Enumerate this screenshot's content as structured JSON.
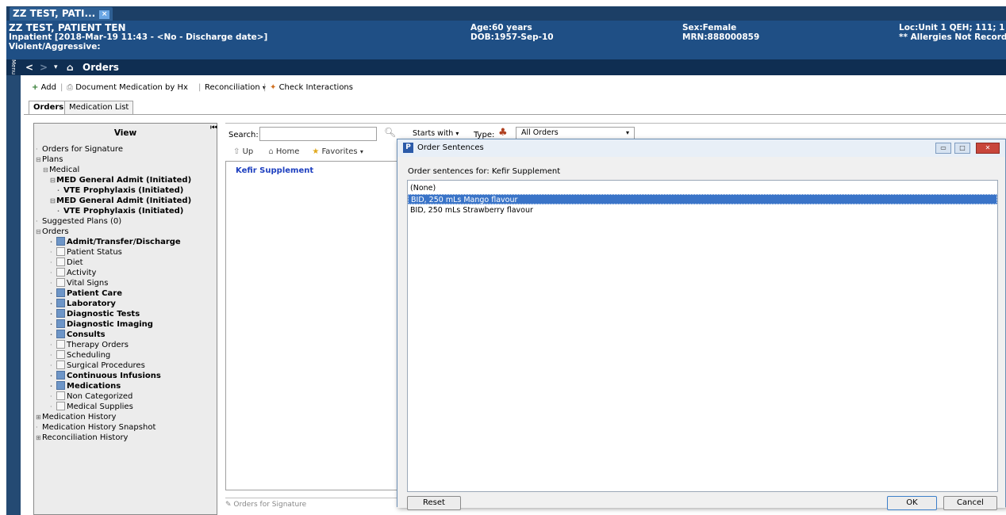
{
  "patient_tab": {
    "label": "ZZ TEST, PATI...",
    "close": "×"
  },
  "banner": {
    "name": "ZZ TEST, PATIENT TEN",
    "encounter": "Inpatient [2018-Mar-19 11:43 - <No - Discharge date>]",
    "alert": "Violent/Aggressive:",
    "age": "Age:60 years",
    "dob": "DOB:1957-Sep-10",
    "sex": "Sex:Female",
    "mrn": "MRN:888000859",
    "loc": "Loc:Unit 1 QEH; 111; 1",
    "allergies": "** Allergies Not Record"
  },
  "navbar": {
    "menu": "Menu",
    "back": "<",
    "forward": ">",
    "page_title": "Orders"
  },
  "toolbar": {
    "add": "Add",
    "document_med": "Document Medication by Hx",
    "reconciliation": "Reconciliation",
    "check_interactions": "Check Interactions"
  },
  "tabs": [
    "Orders",
    "Medication List"
  ],
  "view_panel": {
    "header": "View",
    "items": [
      {
        "label": "Orders for Signature",
        "bold": false,
        "checkbox": "none",
        "indent": 0,
        "expander": ""
      },
      {
        "label": "Plans",
        "bold": false,
        "checkbox": "none",
        "indent": 0,
        "expander": "-"
      },
      {
        "label": "Medical",
        "bold": false,
        "checkbox": "none",
        "indent": 1,
        "expander": "-"
      },
      {
        "label": "MED General Admit (Initiated)",
        "bold": true,
        "checkbox": "none",
        "indent": 2,
        "expander": "-"
      },
      {
        "label": "VTE Prophylaxis (Initiated)",
        "bold": true,
        "checkbox": "none",
        "indent": 3,
        "expander": ""
      },
      {
        "label": "MED General Admit (Initiated)",
        "bold": true,
        "checkbox": "none",
        "indent": 2,
        "expander": "-"
      },
      {
        "label": "VTE Prophylaxis (Initiated)",
        "bold": true,
        "checkbox": "none",
        "indent": 3,
        "expander": ""
      },
      {
        "label": "Suggested Plans (0)",
        "bold": false,
        "checkbox": "none",
        "indent": 0,
        "expander": ""
      },
      {
        "label": "Orders",
        "bold": false,
        "checkbox": "none",
        "indent": 0,
        "expander": "-"
      },
      {
        "label": "Admit/Transfer/Discharge",
        "bold": true,
        "checkbox": "on",
        "indent": 2,
        "expander": ""
      },
      {
        "label": "Patient Status",
        "bold": false,
        "checkbox": "off",
        "indent": 2,
        "expander": ""
      },
      {
        "label": "Diet",
        "bold": false,
        "checkbox": "off",
        "indent": 2,
        "expander": ""
      },
      {
        "label": "Activity",
        "bold": false,
        "checkbox": "off",
        "indent": 2,
        "expander": ""
      },
      {
        "label": "Vital Signs",
        "bold": false,
        "checkbox": "off",
        "indent": 2,
        "expander": ""
      },
      {
        "label": "Patient Care",
        "bold": true,
        "checkbox": "on",
        "indent": 2,
        "expander": ""
      },
      {
        "label": "Laboratory",
        "bold": true,
        "checkbox": "on",
        "indent": 2,
        "expander": ""
      },
      {
        "label": "Diagnostic Tests",
        "bold": true,
        "checkbox": "on",
        "indent": 2,
        "expander": ""
      },
      {
        "label": "Diagnostic Imaging",
        "bold": true,
        "checkbox": "on",
        "indent": 2,
        "expander": ""
      },
      {
        "label": "Consults",
        "bold": true,
        "checkbox": "on",
        "indent": 2,
        "expander": ""
      },
      {
        "label": "Therapy Orders",
        "bold": false,
        "checkbox": "off",
        "indent": 2,
        "expander": ""
      },
      {
        "label": "Scheduling",
        "bold": false,
        "checkbox": "off",
        "indent": 2,
        "expander": ""
      },
      {
        "label": "Surgical Procedures",
        "bold": false,
        "checkbox": "off",
        "indent": 2,
        "expander": ""
      },
      {
        "label": "Continuous Infusions",
        "bold": true,
        "checkbox": "on",
        "indent": 2,
        "expander": ""
      },
      {
        "label": "Medications",
        "bold": true,
        "checkbox": "on",
        "indent": 2,
        "expander": ""
      },
      {
        "label": "Non Categorized",
        "bold": false,
        "checkbox": "off",
        "indent": 2,
        "expander": ""
      },
      {
        "label": "Medical Supplies",
        "bold": false,
        "checkbox": "off",
        "indent": 2,
        "expander": ""
      },
      {
        "label": "Medication History",
        "bold": false,
        "checkbox": "none",
        "indent": 0,
        "expander": "+"
      },
      {
        "label": "Medication History Snapshot",
        "bold": false,
        "checkbox": "none",
        "indent": 0,
        "expander": ""
      },
      {
        "label": "Reconciliation History",
        "bold": false,
        "checkbox": "none",
        "indent": 0,
        "expander": "+"
      }
    ]
  },
  "search": {
    "label": "Search:",
    "value": "",
    "mode": "Starts with",
    "type_label": "Type:",
    "type_value": "All Orders"
  },
  "folder_nav": {
    "up": "Up",
    "home": "Home",
    "favorites": "Favorites"
  },
  "results": [
    "Kefir Supplement"
  ],
  "orders_for_signature_footer": "Orders for Signature",
  "dialog": {
    "title": "Order Sentences",
    "for_label": "Order sentences for:  Kefir Supplement",
    "rows": [
      {
        "text": "(None)",
        "selected": false
      },
      {
        "text": "BID, 250 mLs Mango flavour",
        "selected": true
      },
      {
        "text": "BID, 250 mLs Strawberry flavour",
        "selected": false
      }
    ],
    "reset": "Reset",
    "ok": "OK",
    "cancel": "Cancel"
  }
}
